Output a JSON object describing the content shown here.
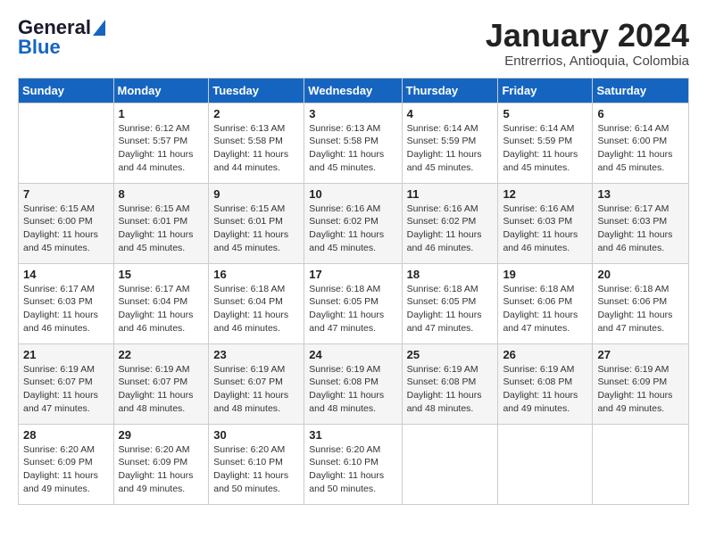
{
  "header": {
    "logo_general": "General",
    "logo_blue": "Blue",
    "month": "January 2024",
    "location": "Entrerrios, Antioquia, Colombia"
  },
  "weekdays": [
    "Sunday",
    "Monday",
    "Tuesday",
    "Wednesday",
    "Thursday",
    "Friday",
    "Saturday"
  ],
  "weeks": [
    [
      {
        "day": "",
        "info": ""
      },
      {
        "day": "1",
        "info": "Sunrise: 6:12 AM\nSunset: 5:57 PM\nDaylight: 11 hours\nand 44 minutes."
      },
      {
        "day": "2",
        "info": "Sunrise: 6:13 AM\nSunset: 5:58 PM\nDaylight: 11 hours\nand 44 minutes."
      },
      {
        "day": "3",
        "info": "Sunrise: 6:13 AM\nSunset: 5:58 PM\nDaylight: 11 hours\nand 45 minutes."
      },
      {
        "day": "4",
        "info": "Sunrise: 6:14 AM\nSunset: 5:59 PM\nDaylight: 11 hours\nand 45 minutes."
      },
      {
        "day": "5",
        "info": "Sunrise: 6:14 AM\nSunset: 5:59 PM\nDaylight: 11 hours\nand 45 minutes."
      },
      {
        "day": "6",
        "info": "Sunrise: 6:14 AM\nSunset: 6:00 PM\nDaylight: 11 hours\nand 45 minutes."
      }
    ],
    [
      {
        "day": "7",
        "info": "Sunrise: 6:15 AM\nSunset: 6:00 PM\nDaylight: 11 hours\nand 45 minutes."
      },
      {
        "day": "8",
        "info": "Sunrise: 6:15 AM\nSunset: 6:01 PM\nDaylight: 11 hours\nand 45 minutes."
      },
      {
        "day": "9",
        "info": "Sunrise: 6:15 AM\nSunset: 6:01 PM\nDaylight: 11 hours\nand 45 minutes."
      },
      {
        "day": "10",
        "info": "Sunrise: 6:16 AM\nSunset: 6:02 PM\nDaylight: 11 hours\nand 45 minutes."
      },
      {
        "day": "11",
        "info": "Sunrise: 6:16 AM\nSunset: 6:02 PM\nDaylight: 11 hours\nand 46 minutes."
      },
      {
        "day": "12",
        "info": "Sunrise: 6:16 AM\nSunset: 6:03 PM\nDaylight: 11 hours\nand 46 minutes."
      },
      {
        "day": "13",
        "info": "Sunrise: 6:17 AM\nSunset: 6:03 PM\nDaylight: 11 hours\nand 46 minutes."
      }
    ],
    [
      {
        "day": "14",
        "info": "Sunrise: 6:17 AM\nSunset: 6:03 PM\nDaylight: 11 hours\nand 46 minutes."
      },
      {
        "day": "15",
        "info": "Sunrise: 6:17 AM\nSunset: 6:04 PM\nDaylight: 11 hours\nand 46 minutes."
      },
      {
        "day": "16",
        "info": "Sunrise: 6:18 AM\nSunset: 6:04 PM\nDaylight: 11 hours\nand 46 minutes."
      },
      {
        "day": "17",
        "info": "Sunrise: 6:18 AM\nSunset: 6:05 PM\nDaylight: 11 hours\nand 47 minutes."
      },
      {
        "day": "18",
        "info": "Sunrise: 6:18 AM\nSunset: 6:05 PM\nDaylight: 11 hours\nand 47 minutes."
      },
      {
        "day": "19",
        "info": "Sunrise: 6:18 AM\nSunset: 6:06 PM\nDaylight: 11 hours\nand 47 minutes."
      },
      {
        "day": "20",
        "info": "Sunrise: 6:18 AM\nSunset: 6:06 PM\nDaylight: 11 hours\nand 47 minutes."
      }
    ],
    [
      {
        "day": "21",
        "info": "Sunrise: 6:19 AM\nSunset: 6:07 PM\nDaylight: 11 hours\nand 47 minutes."
      },
      {
        "day": "22",
        "info": "Sunrise: 6:19 AM\nSunset: 6:07 PM\nDaylight: 11 hours\nand 48 minutes."
      },
      {
        "day": "23",
        "info": "Sunrise: 6:19 AM\nSunset: 6:07 PM\nDaylight: 11 hours\nand 48 minutes."
      },
      {
        "day": "24",
        "info": "Sunrise: 6:19 AM\nSunset: 6:08 PM\nDaylight: 11 hours\nand 48 minutes."
      },
      {
        "day": "25",
        "info": "Sunrise: 6:19 AM\nSunset: 6:08 PM\nDaylight: 11 hours\nand 48 minutes."
      },
      {
        "day": "26",
        "info": "Sunrise: 6:19 AM\nSunset: 6:08 PM\nDaylight: 11 hours\nand 49 minutes."
      },
      {
        "day": "27",
        "info": "Sunrise: 6:19 AM\nSunset: 6:09 PM\nDaylight: 11 hours\nand 49 minutes."
      }
    ],
    [
      {
        "day": "28",
        "info": "Sunrise: 6:20 AM\nSunset: 6:09 PM\nDaylight: 11 hours\nand 49 minutes."
      },
      {
        "day": "29",
        "info": "Sunrise: 6:20 AM\nSunset: 6:09 PM\nDaylight: 11 hours\nand 49 minutes."
      },
      {
        "day": "30",
        "info": "Sunrise: 6:20 AM\nSunset: 6:10 PM\nDaylight: 11 hours\nand 50 minutes."
      },
      {
        "day": "31",
        "info": "Sunrise: 6:20 AM\nSunset: 6:10 PM\nDaylight: 11 hours\nand 50 minutes."
      },
      {
        "day": "",
        "info": ""
      },
      {
        "day": "",
        "info": ""
      },
      {
        "day": "",
        "info": ""
      }
    ]
  ]
}
